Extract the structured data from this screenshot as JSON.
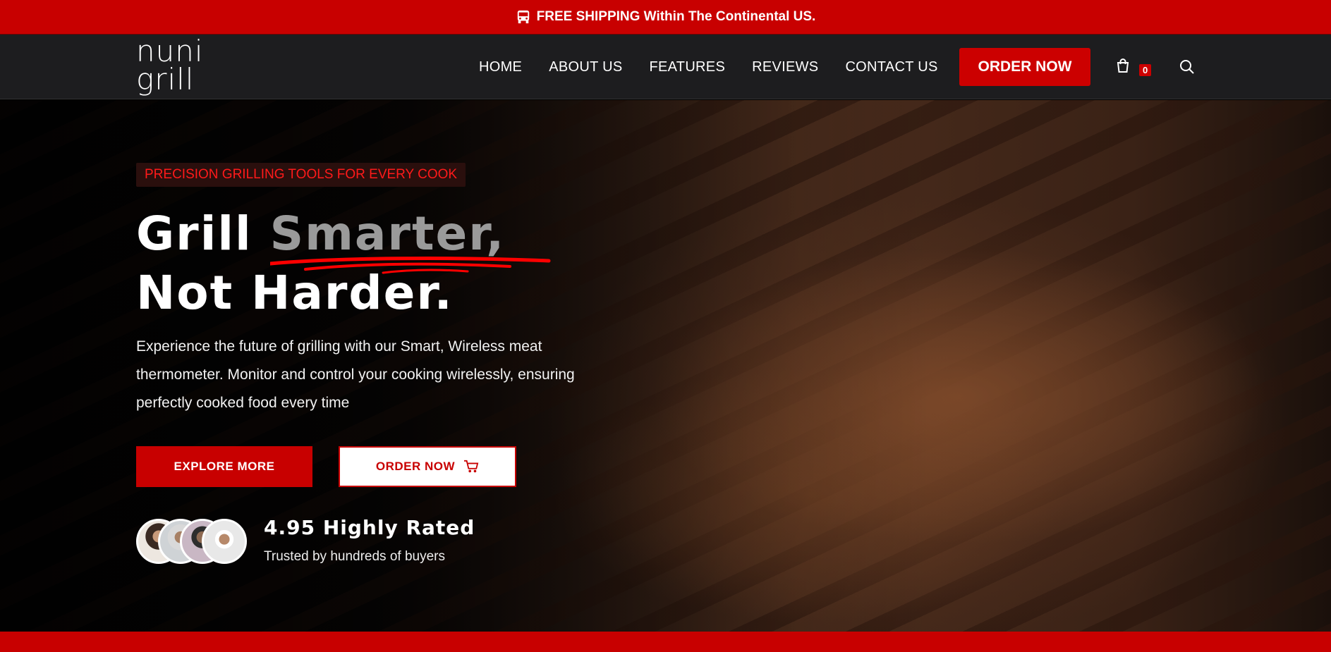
{
  "topbar": {
    "icon": "bus-icon",
    "text": "FREE SHIPPING Within The Continental US."
  },
  "logo": {
    "line1": "nuni",
    "line2": "grill"
  },
  "nav": {
    "items": [
      {
        "label": "HOME"
      },
      {
        "label": "ABOUT US"
      },
      {
        "label": "FEATURES"
      },
      {
        "label": "REVIEWS"
      },
      {
        "label": "CONTACT US"
      }
    ],
    "order_label": "ORDER NOW",
    "cart_count": "0",
    "cart_icon": "shopping-bag-icon",
    "search_icon": "search-icon"
  },
  "hero": {
    "tagline": "PRECISION GRILLING TOOLS FOR EVERY COOK",
    "title_part1": "Grill ",
    "title_highlight": "Smarter,",
    "title_line2": "Not Harder.",
    "description": "Experience the future of grilling with our Smart, Wireless meat thermometer. Monitor and control your cooking wirelessly, ensuring perfectly cooked food every time",
    "explore_label": "EXPLORE MORE",
    "order_label": "ORDER NOW",
    "rating_text": "4.95 Highly Rated",
    "trusted_text": "Trusted by hundreds of buyers"
  },
  "colors": {
    "brand_red": "#c80000",
    "nav_bg": "#1d1d1f"
  }
}
